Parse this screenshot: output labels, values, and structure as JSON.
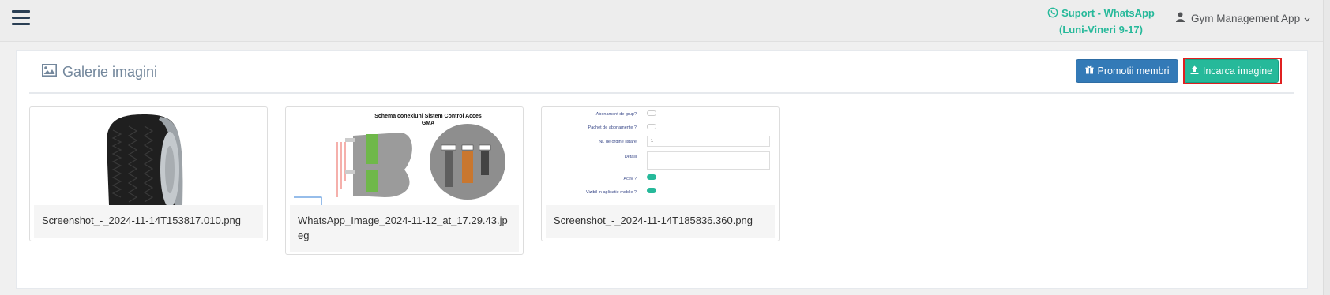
{
  "header": {
    "support_line1": "Suport - WhatsApp",
    "support_line2": "(Luni-Vineri 9-17)",
    "user_label": "Gym Management App",
    "support_icon": "whatsapp-icon",
    "user_icon": "user-icon",
    "menu_icon": "hamburger-icon"
  },
  "gallery": {
    "title": "Galerie imagini",
    "title_icon": "image-icon",
    "promo_button": "Promotii membri",
    "promo_icon": "gift-icon",
    "upload_button": "Incarca imagine",
    "upload_icon": "upload-icon",
    "items": [
      {
        "filename": "Screenshot_-_2024-11-14T153817.010.png",
        "thumb": "tire-photo"
      },
      {
        "filename": "WhatsApp_Image_2024-11-12_at_17.29.43.jpeg",
        "thumb": "wiring-schematic",
        "thumb_title": "Schema conexiuni Sistem Control Acces",
        "thumb_subtitle": "GMA"
      },
      {
        "filename": "Screenshot_-_2024-11-14T185836.360.png",
        "thumb": "settings-form",
        "form_rows": [
          "Abonament de grup?",
          "Pachet de abonamente ?",
          "Nr. de ordine listare",
          "Detalii",
          "Activ ?",
          "Vizibil in aplicatie mobile ?"
        ],
        "order_value": "1"
      }
    ]
  },
  "colors": {
    "accent_green": "#26b99a",
    "button_blue": "#337ab7",
    "highlight_red": "#e02020",
    "title_grey": "#73879c"
  }
}
